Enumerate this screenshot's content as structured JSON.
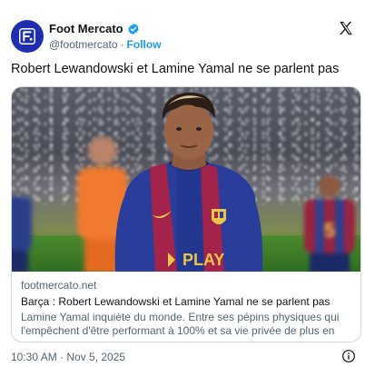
{
  "account": {
    "name": "Foot Mercato",
    "handle": "@footmercato",
    "separator": "·",
    "follow_label": "Follow",
    "brand_color": "#1d2fb0",
    "verified_color": "#1d9bf0"
  },
  "tweet": {
    "text": "Robert Lewandowski et Lamine Yamal ne se parlent pas"
  },
  "link_card": {
    "domain": "footmercato.net",
    "title": "Barça : Robert Lewandowski et Lamine Yamal ne se parlent pas",
    "description": "Lamine Yamal inquiète du monde. Entre ses pépins physiques qui l'empêchent d'être performant à 100% et sa vie privée de plus en plus ...",
    "image_icon": "football-player-photo",
    "jersey_sponsor": "PLAY"
  },
  "footer": {
    "timestamp": "10:30 AM · Nov 5, 2025",
    "info_icon": "info-icon"
  },
  "icons": {
    "avatar": "foot-mercato-logo",
    "verified": "verified-badge-icon",
    "platform": "x-logo-icon"
  }
}
